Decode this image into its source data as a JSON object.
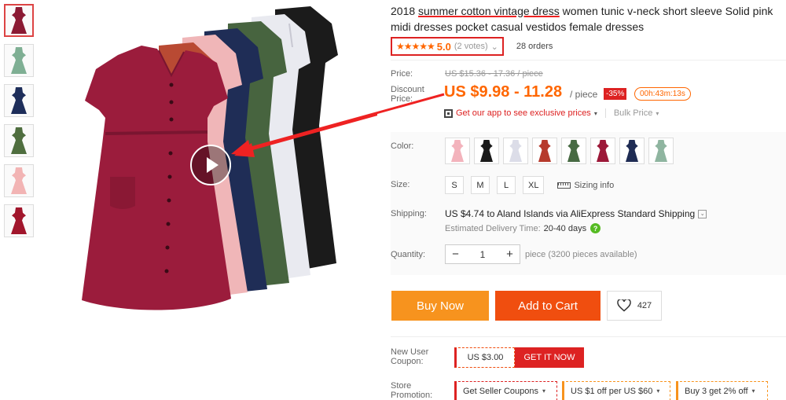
{
  "thumbnails": [
    {
      "color": "#8b1a33"
    },
    {
      "color": "#7faf94"
    },
    {
      "color": "#1e2e5a"
    },
    {
      "color": "#4f6e3f"
    },
    {
      "color": "#f2b4b4"
    },
    {
      "color": "#a1162c"
    }
  ],
  "product": {
    "title_pre": "2018 ",
    "title_underlined": "summer cotton vintage dress",
    "title_post": " women tunic v-neck short sleeve Solid pink midi dresses pocket casual vestidos female dresses"
  },
  "rating": {
    "stars": "★★★★★",
    "value": "5.0",
    "votes": "(2 votes)",
    "votes_caret": "⌄",
    "orders": "28 orders"
  },
  "price": {
    "label": "Price:",
    "original": "US $15.36 - 17.36 / piece",
    "discount_label": "Discount Price:",
    "current": "US $9.98 - 11.28",
    "unit": "/ piece",
    "discount_badge": "-35%",
    "timer": "00h:43m:13s",
    "app_promo": "Get our app to see exclusive prices",
    "app_caret": "▾",
    "bulk": "Bulk Price",
    "bulk_caret": "▾"
  },
  "options": {
    "color_label": "Color:",
    "colors": [
      "#f3b3bc",
      "#1a1a1a",
      "#dcdde8",
      "#b63a2c",
      "#476a43",
      "#9c1838",
      "#1f2c54",
      "#8fb5a0"
    ],
    "size_label": "Size:",
    "sizes": [
      "S",
      "M",
      "L",
      "XL"
    ],
    "sizing_info": "Sizing info",
    "shipping_label": "Shipping:",
    "shipping_text": "US $4.74 to Aland Islands via AliExpress Standard Shipping",
    "shipping_caret": "⌄",
    "delivery_label": "Estimated Delivery Time:",
    "delivery_days": "20-40 days",
    "help_mark": "?",
    "quantity_label": "Quantity:",
    "qty_minus": "−",
    "qty_value": "1",
    "qty_plus": "+",
    "availability": "piece (3200 pieces available)"
  },
  "actions": {
    "buy_now": "Buy Now",
    "add_to_cart": "Add to Cart",
    "wishlist_count": "427"
  },
  "coupon": {
    "label": "New User Coupon:",
    "amount": "US $3.00",
    "cta": "GET IT NOW"
  },
  "store_promo": {
    "label": "Store Promotion:",
    "items": [
      "Get Seller Coupons",
      "US $1 off per US $60",
      "Buy 3 get 2% off"
    ],
    "caret": "▾"
  },
  "colors": {
    "accent_orange": "#f60",
    "annotation_red": "#e22",
    "buy_now_bg": "#f7931e",
    "add_to_cart_bg": "#f04e0f"
  }
}
